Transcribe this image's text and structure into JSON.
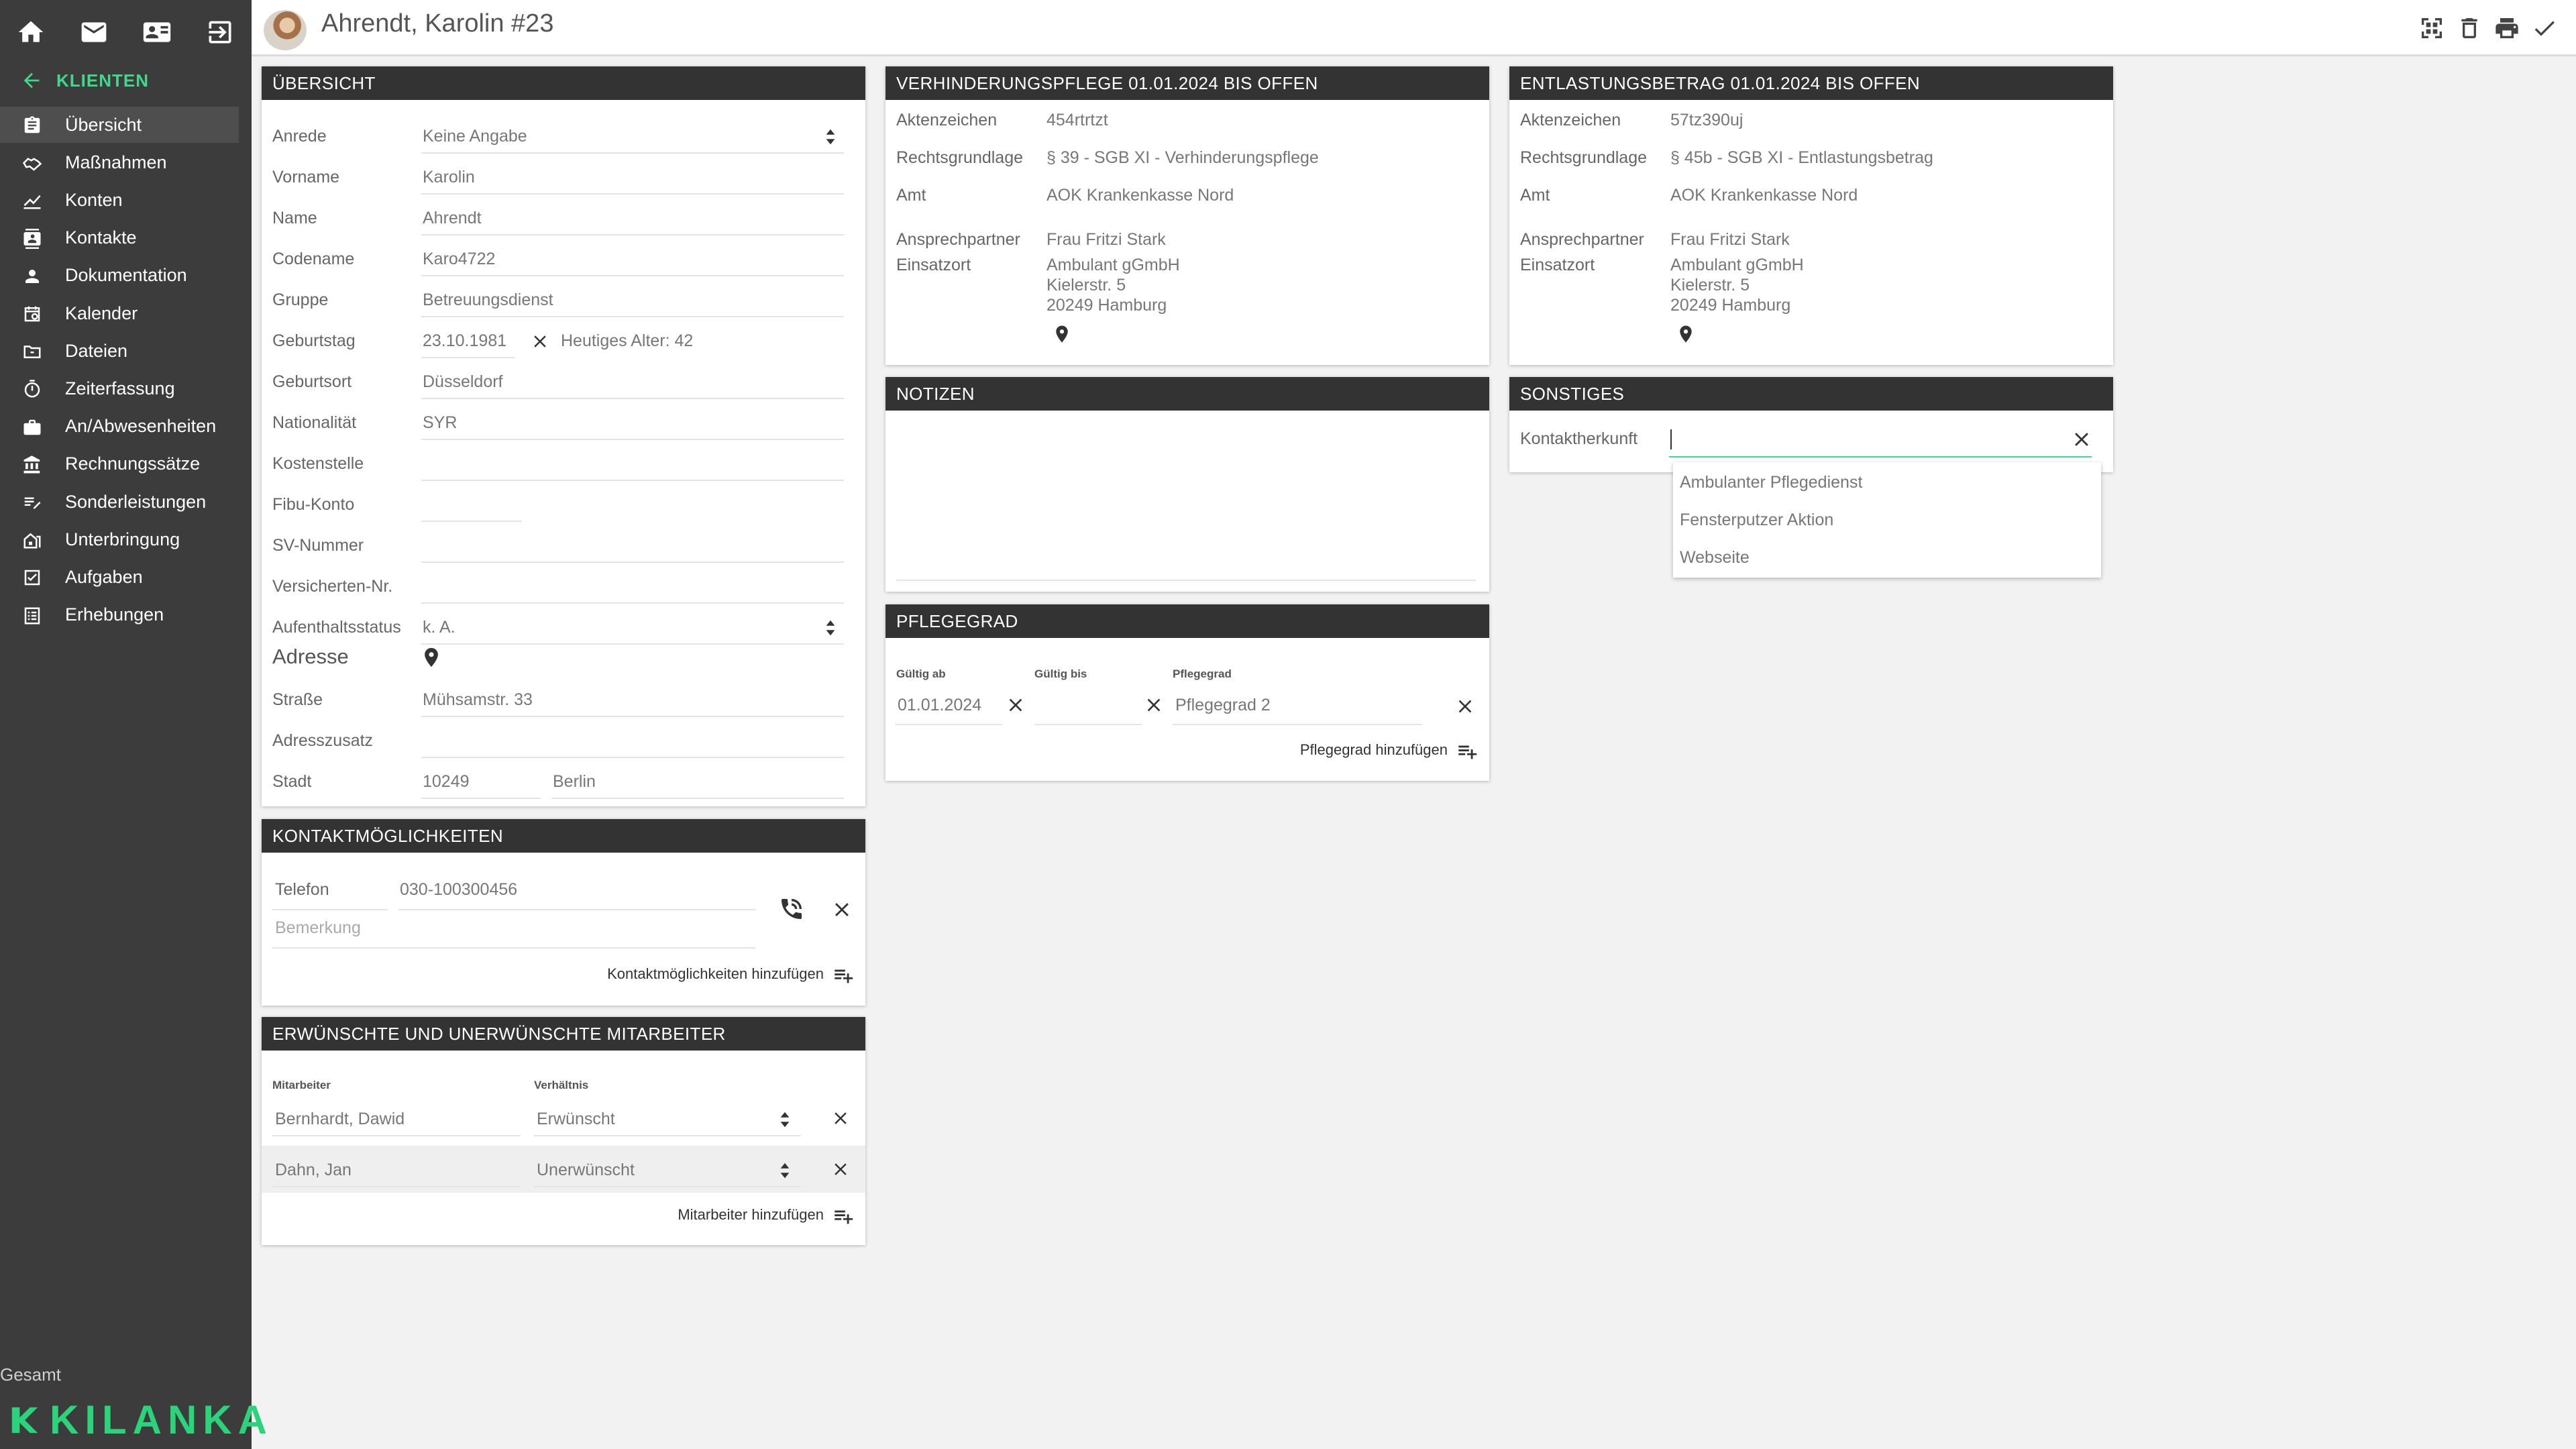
{
  "brand": {
    "name": "KILANKA",
    "accent": "#3fd98a"
  },
  "sidebar": {
    "top_icons": [
      "home-icon",
      "mail-icon",
      "contact-card-icon",
      "logout-icon"
    ],
    "back_label": "KLIENTEN",
    "items": [
      {
        "label": "Übersicht",
        "icon": "clipboard-icon",
        "active": true
      },
      {
        "label": "Maßnahmen",
        "icon": "handshake-icon"
      },
      {
        "label": "Konten",
        "icon": "chart-line-icon"
      },
      {
        "label": "Kontakte",
        "icon": "contacts-icon"
      },
      {
        "label": "Dokumentation",
        "icon": "person-icon"
      },
      {
        "label": "Kalender",
        "icon": "calendar-icon"
      },
      {
        "label": "Dateien",
        "icon": "folder-icon"
      },
      {
        "label": "Zeiterfassung",
        "icon": "stopwatch-icon"
      },
      {
        "label": "An/Abwesenheiten",
        "icon": "briefcase-icon"
      },
      {
        "label": "Rechnungssätze",
        "icon": "bank-icon"
      },
      {
        "label": "Sonderleistungen",
        "icon": "playlist-edit-icon"
      },
      {
        "label": "Unterbringung",
        "icon": "house-icon"
      },
      {
        "label": "Aufgaben",
        "icon": "checkbox-icon"
      },
      {
        "label": "Erhebungen",
        "icon": "list-icon"
      }
    ],
    "footer_label": "Gesamt"
  },
  "header": {
    "title": "Ahrendt, Karolin #23",
    "actions": [
      "qr-scan-icon",
      "trash-icon",
      "print-icon",
      "check-icon"
    ]
  },
  "overview": {
    "title": "ÜBERSICHT",
    "fields": [
      {
        "label": "Anrede",
        "value": "Keine Angabe"
      },
      {
        "label": "Vorname",
        "value": "Karolin"
      },
      {
        "label": "Name",
        "value": "Ahrendt"
      },
      {
        "label": "Codename",
        "value": "Karo4722"
      },
      {
        "label": "Gruppe",
        "value": "Betreuungsdienst"
      },
      {
        "label": "Geburtstag",
        "value": "23.10.1981",
        "extra": "Heutiges Alter: 42"
      },
      {
        "label": "Geburtsort",
        "value": "Düsseldorf"
      },
      {
        "label": "Nationalität",
        "value": "SYR"
      },
      {
        "label": "Kostenstelle",
        "value": ""
      },
      {
        "label": "Fibu-Konto",
        "value": ""
      },
      {
        "label": "SV-Nummer",
        "value": ""
      },
      {
        "label": "Versicherten-Nr.",
        "value": ""
      },
      {
        "label": "Aufenthaltsstatus",
        "value": "k. A."
      }
    ],
    "address_title": "Adresse",
    "address": [
      {
        "label": "Straße",
        "value": "Mühsamstr. 33"
      },
      {
        "label": "Adresszusatz",
        "value": ""
      },
      {
        "label": "Stadt",
        "value": "10249",
        "city": "Berlin"
      }
    ]
  },
  "contact": {
    "title": "KONTAKTMÖGLICHKEITEN",
    "type": "Telefon",
    "number": "030-100300456",
    "remark_placeholder": "Bemerkung",
    "add_label": "Kontaktmöglichkeiten hinzufügen"
  },
  "staff": {
    "title": "ERWÜNSCHTE UND UNERWÜNSCHTE MITARBEITER",
    "col_employee": "Mitarbeiter",
    "col_relation": "Verhältnis",
    "rows": [
      {
        "name": "Bernhardt, Dawid",
        "relation": "Erwünscht"
      },
      {
        "name": "Dahn, Jan",
        "relation": "Unerwünscht"
      }
    ],
    "add_label": "Mitarbeiter hinzufügen"
  },
  "care": {
    "title": "VERHINDERUNGSPFLEGE 01.01.2024 BIS OFFEN",
    "rows": [
      {
        "label": "Aktenzeichen",
        "value": "454rtrtzt"
      },
      {
        "label": "Rechtsgrundlage",
        "value": "§ 39 - SGB XI - Verhinderungspflege"
      },
      {
        "label": "Amt",
        "value": "AOK Krankenkasse Nord"
      },
      {
        "label": "Ansprechpartner",
        "value": "Frau Fritzi Stark"
      }
    ],
    "site_label": "Einsatzort",
    "site": [
      "Ambulant gGmbH",
      "Kielerstr. 5",
      "20249 Hamburg"
    ]
  },
  "relief": {
    "title": "ENTLASTUNGSBETRAG 01.01.2024 BIS OFFEN",
    "rows": [
      {
        "label": "Aktenzeichen",
        "value": "57tz390uj"
      },
      {
        "label": "Rechtsgrundlage",
        "value": "§ 45b - SGB XI - Entlastungsbetrag"
      },
      {
        "label": "Amt",
        "value": "AOK Krankenkasse Nord"
      },
      {
        "label": "Ansprechpartner",
        "value": "Frau Fritzi Stark"
      }
    ],
    "site_label": "Einsatzort",
    "site": [
      "Ambulant gGmbH",
      "Kielerstr. 5",
      "20249 Hamburg"
    ]
  },
  "notes": {
    "title": "NOTIZEN",
    "text": ""
  },
  "level": {
    "title": "PFLEGEGRAD",
    "col_from": "Gültig ab",
    "col_to": "Gültig bis",
    "col_level": "Pflegegrad",
    "from": "01.01.2024",
    "to": "",
    "value": "Pflegegrad 2",
    "add_label": "Pflegegrad hinzufügen"
  },
  "misc": {
    "title": "SONSTIGES",
    "label": "Kontaktherkunft",
    "value": "",
    "options": [
      "Ambulanter Pflegedienst",
      "Fensterputzer Aktion",
      "Webseite"
    ]
  }
}
